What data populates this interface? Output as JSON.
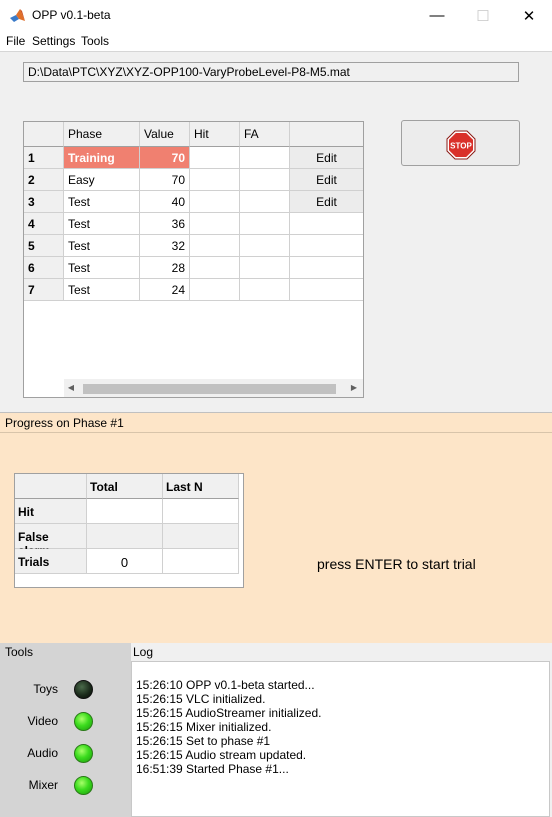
{
  "window": {
    "title": "OPP v0.1-beta",
    "minimize": "—",
    "maximize": "☐",
    "close": "✕"
  },
  "menu": [
    "File",
    "Settings",
    "Tools"
  ],
  "file_path": "D:\\Data\\PTC\\XYZ\\XYZ-OPP100-VaryProbeLevel-P8-M5.mat",
  "phase_table": {
    "columns": [
      "Phase",
      "Value",
      "Hit",
      "FA",
      ""
    ],
    "rows": [
      {
        "index": "1",
        "phase": "Training",
        "value": "70",
        "hit": "",
        "fa": "",
        "action": "Edit"
      },
      {
        "index": "2",
        "phase": "Easy",
        "value": "70",
        "hit": "",
        "fa": "",
        "action": "Edit"
      },
      {
        "index": "3",
        "phase": "Test",
        "value": "40",
        "hit": "",
        "fa": "",
        "action": "Edit"
      },
      {
        "index": "4",
        "phase": "Test",
        "value": "36",
        "hit": "",
        "fa": "",
        "action": ""
      },
      {
        "index": "5",
        "phase": "Test",
        "value": "32",
        "hit": "",
        "fa": "",
        "action": ""
      },
      {
        "index": "6",
        "phase": "Test",
        "value": "28",
        "hit": "",
        "fa": "",
        "action": ""
      },
      {
        "index": "7",
        "phase": "Test",
        "value": "24",
        "hit": "",
        "fa": "",
        "action": ""
      }
    ],
    "highlight_color": "#f08070"
  },
  "stop_button": {
    "icon": "stop-sign-icon",
    "text": "STOP",
    "color": "#d9302a"
  },
  "progress": {
    "title": "Progress on Phase #1",
    "background": "#fde5c8",
    "stats": {
      "columns": [
        "Total",
        "Last N"
      ],
      "rows": [
        {
          "label": "Hit",
          "total": "",
          "last_n": ""
        },
        {
          "label": "False alarm",
          "total": "",
          "last_n": ""
        },
        {
          "label": "Trials",
          "total": "0",
          "last_n": ""
        }
      ]
    },
    "message": "press ENTER to start trial"
  },
  "tools": {
    "title": "Tools",
    "items": [
      {
        "label": "Toys",
        "status": "off"
      },
      {
        "label": "Video",
        "status": "on"
      },
      {
        "label": "Audio",
        "status": "on"
      },
      {
        "label": "Mixer",
        "status": "on"
      }
    ]
  },
  "log": {
    "title": "Log",
    "lines": [
      "15:26:10  OPP v0.1-beta started...",
      "15:26:15  VLC initialized.",
      "15:26:15  AudioStreamer initialized.",
      "15:26:15  Mixer initialized.",
      "15:26:15  Set to phase #1",
      "15:26:15  Audio stream updated.",
      "16:51:39  Started Phase #1..."
    ]
  }
}
